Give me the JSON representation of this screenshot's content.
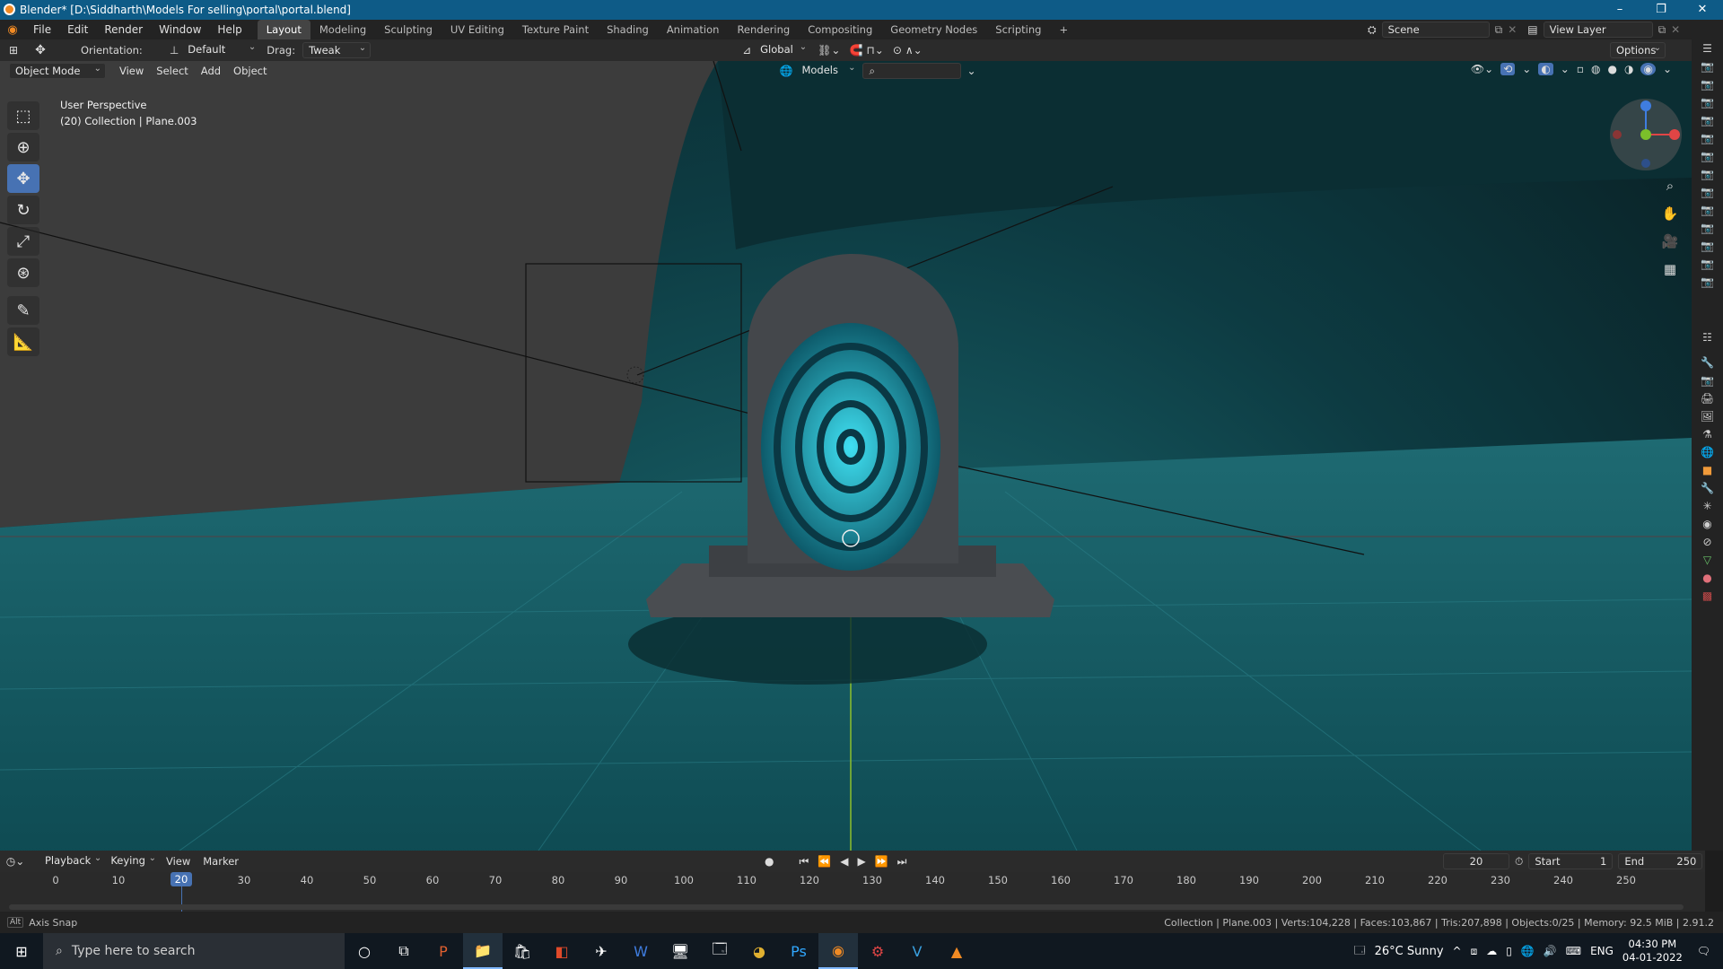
{
  "window": {
    "title": "Blender* [D:\\Siddharth\\Models For selling\\portal\\portal.blend]",
    "controls": [
      "–",
      "❐",
      "✕"
    ]
  },
  "menu": [
    "File",
    "Edit",
    "Render",
    "Window",
    "Help"
  ],
  "workspaces": [
    "Layout",
    "Modeling",
    "Sculpting",
    "UV Editing",
    "Texture Paint",
    "Shading",
    "Animation",
    "Rendering",
    "Compositing",
    "Geometry Nodes",
    "Scripting"
  ],
  "workspace_add": "+",
  "scene": {
    "label": "Scene",
    "view_layer": "View Layer"
  },
  "header": {
    "orientation_label": "Orientation:",
    "orientation_value": "Default",
    "drag_label": "Drag:",
    "drag_value": "Tweak",
    "transform_space": "Global",
    "options": "Options"
  },
  "viewport_header": {
    "mode": "Object Mode",
    "menus": [
      "View",
      "Select",
      "Add",
      "Object"
    ],
    "collection_filter": "Models"
  },
  "viewport": {
    "perspective": "User Perspective",
    "collection_info": "(20) Collection | Plane.003",
    "accent_color": "#28c6e0"
  },
  "tools": [
    "select-box",
    "cursor",
    "move",
    "rotate",
    "scale",
    "transform",
    "annotate",
    "measure"
  ],
  "timeline": {
    "menus": [
      "Playback",
      "Keying",
      "View",
      "Marker"
    ],
    "current_frame": "20",
    "start_label": "Start",
    "start_value": "1",
    "end_label": "End",
    "end_value": "250",
    "ticks": [
      "0",
      "10",
      "20",
      "30",
      "40",
      "50",
      "60",
      "70",
      "80",
      "90",
      "100",
      "110",
      "120",
      "130",
      "140",
      "150",
      "160",
      "170",
      "180",
      "190",
      "200",
      "210",
      "220",
      "230",
      "240",
      "250"
    ],
    "playhead": "20"
  },
  "status": {
    "left": "Axis Snap",
    "right": "Collection | Plane.003 | Verts:104,228 | Faces:103,867 | Tris:207,898 | Objects:0/25 | Memory: 92.5 MiB | 2.91.2"
  },
  "taskbar": {
    "search_placeholder": "Type here to search",
    "weather": "26°C  Sunny",
    "lang": "ENG",
    "time": "04:30 PM",
    "date": "04-01-2022"
  }
}
